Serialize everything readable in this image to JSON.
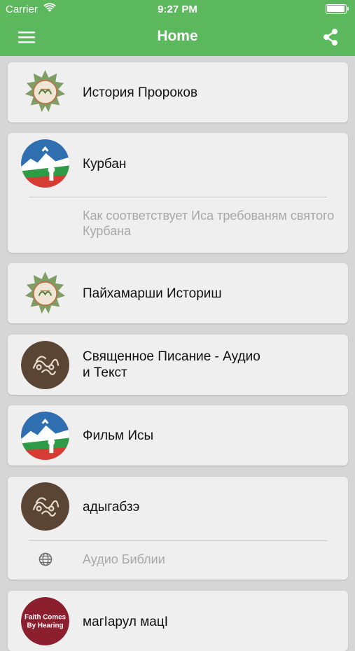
{
  "status_bar": {
    "carrier": "Carrier",
    "time": "9:27 PM",
    "battery_level": 1.0
  },
  "nav": {
    "title": "Home"
  },
  "colors": {
    "accent": "#5cb85c",
    "card_bg": "#efefef",
    "page_bg": "#d6d6d6"
  },
  "items": [
    {
      "title": "История Пророков",
      "icon": "arabic-calligraphy-icon"
    },
    {
      "title": "Курбан",
      "subtitle": "Как соответствует Иса требованям святого Курбана",
      "icon": "dagestan-landscape-icon"
    },
    {
      "title": "Пайхамарши Историш",
      "icon": "arabic-calligraphy-icon"
    },
    {
      "title_lines": [
        "Священное Писание - Аудио",
        "и Текст"
      ],
      "icon": "brown-calligraphy-circle-icon"
    },
    {
      "title": "Фильм Исы",
      "icon": "dagestan-landscape-icon"
    },
    {
      "title": "адыгабзэ",
      "subtitle": "Аудио Библии",
      "icon": "brown-calligraphy-circle-icon",
      "sub_icon": "globe-icon"
    },
    {
      "title": "магIарул мацI",
      "icon": "faith-comes-by-hearing-logo",
      "logo_text": "Faith Comes By Hearing"
    }
  ]
}
